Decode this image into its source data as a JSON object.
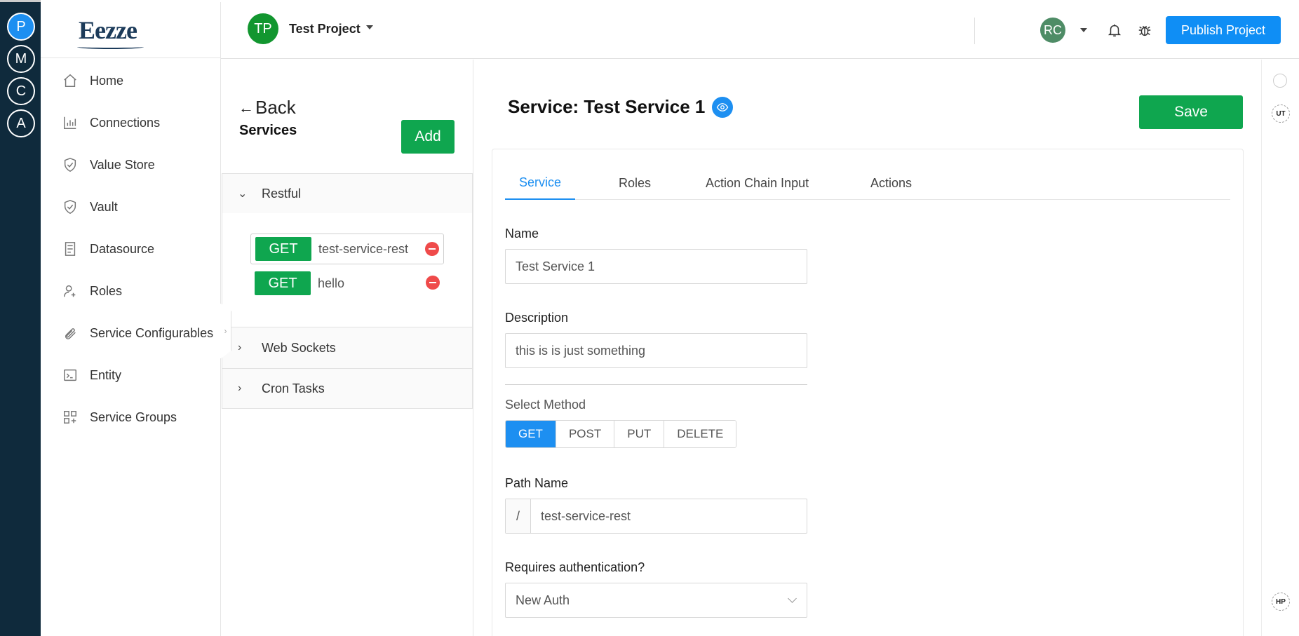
{
  "rail": {
    "items": [
      "P",
      "M",
      "C",
      "A"
    ]
  },
  "logo": {
    "text": "Eezze"
  },
  "sidebar": {
    "items": [
      {
        "label": "Home",
        "icon": "home-icon"
      },
      {
        "label": "Connections",
        "icon": "bar-chart-icon"
      },
      {
        "label": "Value Store",
        "icon": "shield-check-icon"
      },
      {
        "label": "Vault",
        "icon": "shield-check-icon"
      },
      {
        "label": "Datasource",
        "icon": "file-list-icon"
      },
      {
        "label": "Roles",
        "icon": "user-add-icon"
      },
      {
        "label": "Service Configurables",
        "icon": "paperclip-icon"
      },
      {
        "label": "Entity",
        "icon": "terminal-icon"
      },
      {
        "label": "Service Groups",
        "icon": "grid-plus-icon"
      }
    ]
  },
  "header": {
    "project_initials": "TP",
    "project_name": "Test Project",
    "user_initials": "RC",
    "publish_label": "Publish Project",
    "colors": {
      "project_avatar": "#12962f",
      "user_avatar": "#4e8c66",
      "publish": "#0f8ef5"
    }
  },
  "services_panel": {
    "back_label": "Back",
    "title": "Services",
    "add_label": "Add",
    "groups": {
      "restful": "Restful",
      "websockets": "Web Sockets",
      "cron": "Cron Tasks"
    },
    "routes": [
      {
        "method": "GET",
        "path": "test-service-rest"
      },
      {
        "method": "GET",
        "path": "hello"
      }
    ]
  },
  "main": {
    "heading": "Service: Test Service 1",
    "save_label": "Save",
    "tabs": [
      "Service",
      "Roles",
      "Action Chain Input",
      "Actions"
    ],
    "form": {
      "name_label": "Name",
      "name_value": "Test Service 1",
      "description_label": "Description",
      "description_value": "this is is just something",
      "method_label": "Select Method",
      "methods": [
        "GET",
        "POST",
        "PUT",
        "DELETE"
      ],
      "selected_method": "GET",
      "path_label": "Path Name",
      "path_prefix": "/",
      "path_value": "test-service-rest",
      "auth_label": "Requires authentication?",
      "auth_value": "New Auth"
    }
  },
  "right_rail": {
    "badge_top": "UT",
    "badge_bottom": "HP"
  }
}
